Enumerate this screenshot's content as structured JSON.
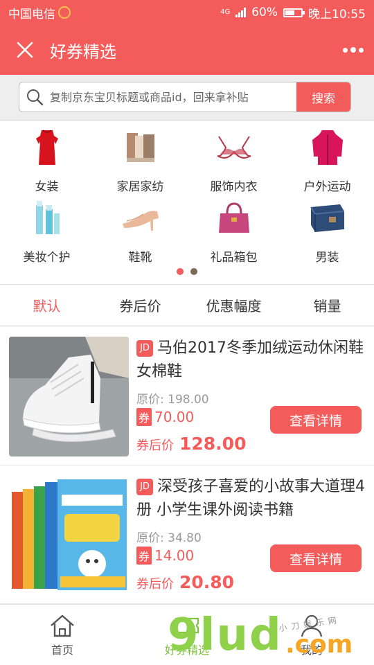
{
  "status_bar": {
    "carrier": "中国电信",
    "network": "4G",
    "battery_level": 0.6,
    "battery_text": "60%",
    "time": "晚上10:55"
  },
  "nav": {
    "title": "好券精选"
  },
  "search": {
    "placeholder": "复制京东宝贝标题或商品id，回来拿补贴",
    "button_label": "搜索"
  },
  "categories": [
    {
      "label": "女装",
      "icon": "dress-icon"
    },
    {
      "label": "家居家纺",
      "icon": "towels-icon"
    },
    {
      "label": "服饰内衣",
      "icon": "lingerie-icon"
    },
    {
      "label": "户外运动",
      "icon": "jacket-icon"
    },
    {
      "label": "美妆个护",
      "icon": "cosmetics-icon"
    },
    {
      "label": "鞋靴",
      "icon": "high-heel-icon"
    },
    {
      "label": "礼品箱包",
      "icon": "handbag-icon"
    },
    {
      "label": "男装",
      "icon": "jeans-icon"
    }
  ],
  "carousel": {
    "pages": 2,
    "active_page": 1,
    "active_color": "#f45c5c",
    "inactive_color": "#7a6a5a"
  },
  "sort_tabs": [
    {
      "label": "默认",
      "active": true
    },
    {
      "label": "券后价",
      "active": false
    },
    {
      "label": "优惠幅度",
      "active": false
    },
    {
      "label": "销量",
      "active": false
    }
  ],
  "products": [
    {
      "badge": "JD",
      "title": "马伯2017冬季加绒运动休闲鞋女棉鞋",
      "original_price_label": "原价: 198.00",
      "coupon_tag": "券",
      "coupon_value": "70.00",
      "after_label": "券后价",
      "after_price": "128.00",
      "detail_label": "查看详情",
      "image": "white-sneaker-photo"
    },
    {
      "badge": "JD",
      "title": "深受孩子喜爱的小故事大道理4册 小学生课外阅读书籍",
      "original_price_label": "原价: 34.80",
      "coupon_tag": "券",
      "coupon_value": "14.00",
      "after_label": "券后价",
      "after_price": "20.80",
      "detail_label": "查看详情",
      "image": "storybook-set-photo"
    }
  ],
  "tabbar": [
    {
      "label": "首页",
      "icon": "home-icon",
      "active": false
    },
    {
      "label": "好券精选",
      "icon": "coupon-icon",
      "active": true
    },
    {
      "label": "我的",
      "icon": "user-icon",
      "active": false
    }
  ],
  "watermark": {
    "main": "9lud",
    "suffix": ".com",
    "shop": "小刀娱乐网"
  },
  "colors": {
    "brand": "#f45c5c",
    "tab_active": "#7cc43b"
  }
}
